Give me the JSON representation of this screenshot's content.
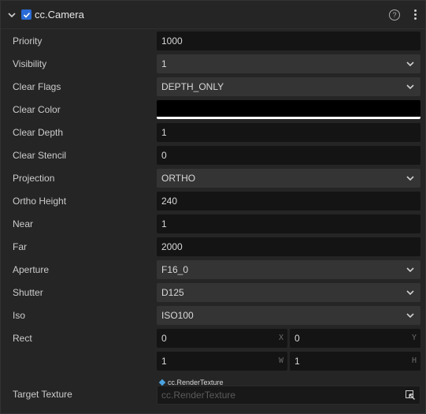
{
  "component": {
    "title": "cc.Camera",
    "enabled": true
  },
  "rows": [
    {
      "label": "Priority",
      "value": "1000",
      "type": "number"
    },
    {
      "label": "Visibility",
      "value": "1",
      "type": "select"
    },
    {
      "label": "Clear Flags",
      "value": "DEPTH_ONLY",
      "type": "select"
    },
    {
      "label": "Clear Color",
      "value": "#000000",
      "type": "color"
    },
    {
      "label": "Clear Depth",
      "value": "1",
      "type": "number"
    },
    {
      "label": "Clear Stencil",
      "value": "0",
      "type": "number"
    },
    {
      "label": "Projection",
      "value": "ORTHO",
      "type": "select"
    },
    {
      "label": "Ortho Height",
      "value": "240",
      "type": "number"
    },
    {
      "label": "Near",
      "value": "1",
      "type": "number"
    },
    {
      "label": "Far",
      "value": "2000",
      "type": "number"
    },
    {
      "label": "Aperture",
      "value": "F16_0",
      "type": "select"
    },
    {
      "label": "Shutter",
      "value": "D125",
      "type": "select"
    },
    {
      "label": "Iso",
      "value": "ISO100",
      "type": "select"
    }
  ],
  "rect": {
    "label": "Rect",
    "x": "0",
    "y": "0",
    "w": "1",
    "h": "1",
    "axis_x": "X",
    "axis_y": "Y",
    "axis_w": "W",
    "axis_h": "H"
  },
  "target_texture": {
    "label": "Target Texture",
    "asset_type": "cc.RenderTexture",
    "placeholder": "cc.RenderTexture"
  },
  "colors": {
    "accent": "#2a6bd6",
    "asset_icon": "#4aa3e0",
    "clear_color": "#000000"
  }
}
